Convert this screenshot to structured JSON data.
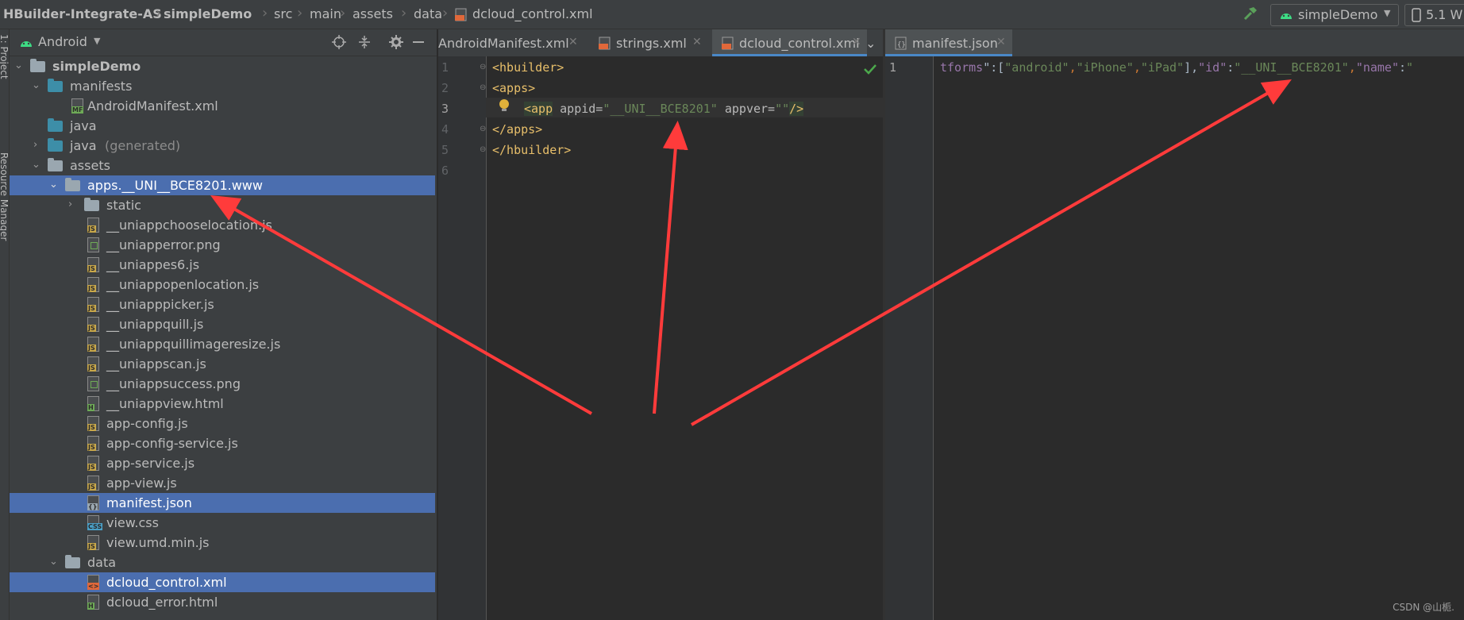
{
  "navbar": {
    "crumbs": [
      "HBuilder-Integrate-AS",
      "simpleDemo",
      "src",
      "main",
      "assets",
      "data",
      "dcloud_control.xml"
    ],
    "run_config": "simpleDemo",
    "device": "5.1  W"
  },
  "tool_stripe": {
    "project_label": "1: Project",
    "resource_label": "Resource Manager"
  },
  "project_panel": {
    "view_mode": "Android",
    "tree": [
      {
        "label": "simpleDemo",
        "bold": true
      },
      {
        "label": "manifests"
      },
      {
        "label": "AndroidManifest.xml"
      },
      {
        "label": "java"
      },
      {
        "label": "java",
        "suffix": "(generated)"
      },
      {
        "label": "assets"
      },
      {
        "label": "apps.__UNI__BCE8201.www",
        "selected": true
      },
      {
        "label": "static"
      },
      {
        "label": "__uniappchooselocation.js"
      },
      {
        "label": "__uniapperror.png"
      },
      {
        "label": "__uniappes6.js"
      },
      {
        "label": "__uniappopenlocation.js"
      },
      {
        "label": "__uniapppicker.js"
      },
      {
        "label": "__uniappquill.js"
      },
      {
        "label": "__uniappquillimageresize.js"
      },
      {
        "label": "__uniappscan.js"
      },
      {
        "label": "__uniappsuccess.png"
      },
      {
        "label": "__uniappview.html"
      },
      {
        "label": "app-config.js"
      },
      {
        "label": "app-config-service.js"
      },
      {
        "label": "app-service.js"
      },
      {
        "label": "app-view.js"
      },
      {
        "label": "manifest.json",
        "selected": true
      },
      {
        "label": "view.css"
      },
      {
        "label": "view.umd.min.js"
      },
      {
        "label": "data"
      },
      {
        "label": "dcloud_control.xml",
        "selected": true
      },
      {
        "label": "dcloud_error.html"
      }
    ]
  },
  "editor_left": {
    "tabs": [
      "AndroidManifest.xml",
      "strings.xml",
      "dcloud_control.xml"
    ],
    "active_tab": "dcloud_control.xml",
    "line_numbers": [
      "1",
      "2",
      "3",
      "4",
      "5",
      "6"
    ],
    "lines": {
      "l1_tag": "<hbuilder>",
      "l2_tag": "<apps>",
      "l3_open": "<app",
      "l3_attr1": " appid=",
      "l3_val1": "\"__UNI__BCE8201\"",
      "l3_attr2": " appver=",
      "l3_val2": "\"\"",
      "l3_close": "/>",
      "l4_tag": "</apps>",
      "l5_tag": "</hbuilder>"
    }
  },
  "editor_right": {
    "tab": "manifest.json",
    "line_numbers": [
      "1"
    ],
    "line": {
      "k1": "tforms",
      "p1": "\":[",
      "s1": "\"android\"",
      "c1": ",",
      "s2": "\"iPhone\"",
      "c2": ",",
      "s3": "\"iPad\"",
      "p2": "],",
      "k2": "\"id\"",
      "c3": ":",
      "s4": "\"__UNI__BCE8201\"",
      "c4": ",",
      "k3": "\"name\"",
      "c5": ":",
      "s5": "\""
    }
  },
  "watermark": "CSDN @山栀.",
  "colors": {
    "selection": "#4b6eaf",
    "annotation_arrow": "#ff3b3b",
    "accent_tab": "#4a88c7"
  }
}
